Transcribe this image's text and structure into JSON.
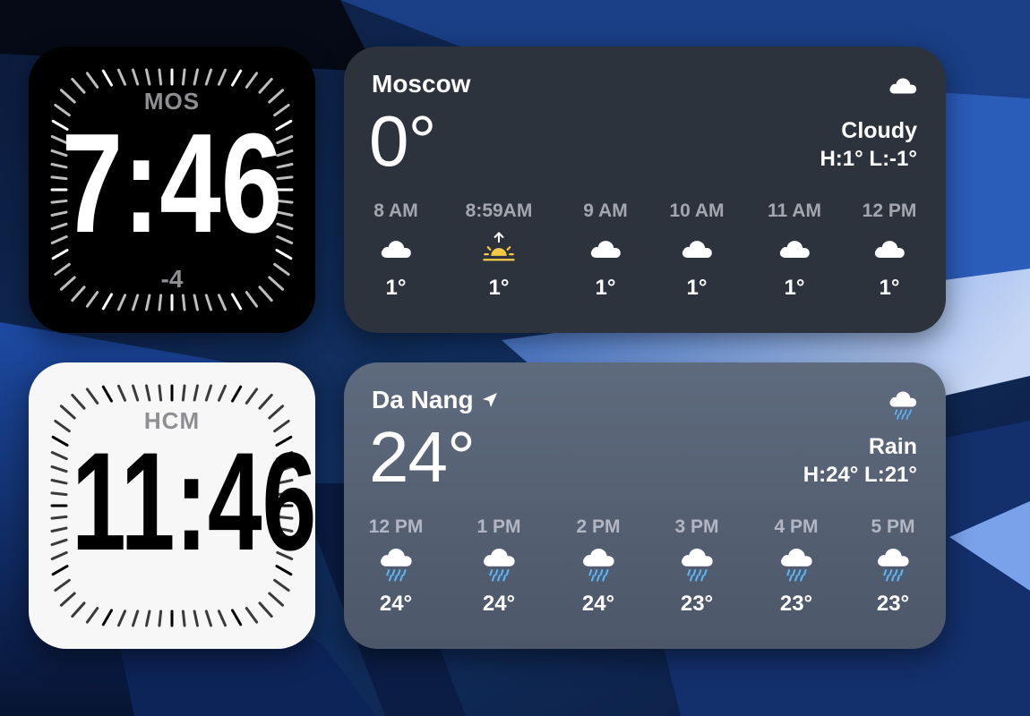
{
  "clocks": [
    {
      "city": "MOS",
      "time": "7:46",
      "offset": "-4"
    },
    {
      "city": "HCM",
      "time": "11:46"
    }
  ],
  "weather": [
    {
      "city": "Moscow",
      "location_icon": "",
      "temp": "0°",
      "icon": "cloud-icon",
      "condition": "Cloudy",
      "hilo": "H:1° L:-1°",
      "hourly": [
        {
          "time": "8 AM",
          "icon": "cloud-icon",
          "temp": "1°"
        },
        {
          "time": "8:59AM",
          "icon": "sunrise-icon",
          "temp": "1°"
        },
        {
          "time": "9 AM",
          "icon": "cloud-icon",
          "temp": "1°"
        },
        {
          "time": "10 AM",
          "icon": "cloud-icon",
          "temp": "1°"
        },
        {
          "time": "11 AM",
          "icon": "cloud-icon",
          "temp": "1°"
        },
        {
          "time": "12 PM",
          "icon": "cloud-icon",
          "temp": "1°"
        }
      ]
    },
    {
      "city": "Da Nang",
      "location_icon": "location-arrow-icon",
      "temp": "24°",
      "icon": "cloud-rain-icon",
      "condition": "Rain",
      "hilo": "H:24° L:21°",
      "hourly": [
        {
          "time": "12 PM",
          "icon": "cloud-rain-icon",
          "temp": "24°"
        },
        {
          "time": "1 PM",
          "icon": "cloud-rain-icon",
          "temp": "24°"
        },
        {
          "time": "2 PM",
          "icon": "cloud-rain-icon",
          "temp": "24°"
        },
        {
          "time": "3 PM",
          "icon": "cloud-rain-icon",
          "temp": "23°"
        },
        {
          "time": "4 PM",
          "icon": "cloud-rain-icon",
          "temp": "23°"
        },
        {
          "time": "5 PM",
          "icon": "cloud-rain-icon",
          "temp": "23°"
        }
      ]
    }
  ],
  "colors": {
    "sunrise": "#f6c945",
    "rain": "#5ab4f5"
  }
}
